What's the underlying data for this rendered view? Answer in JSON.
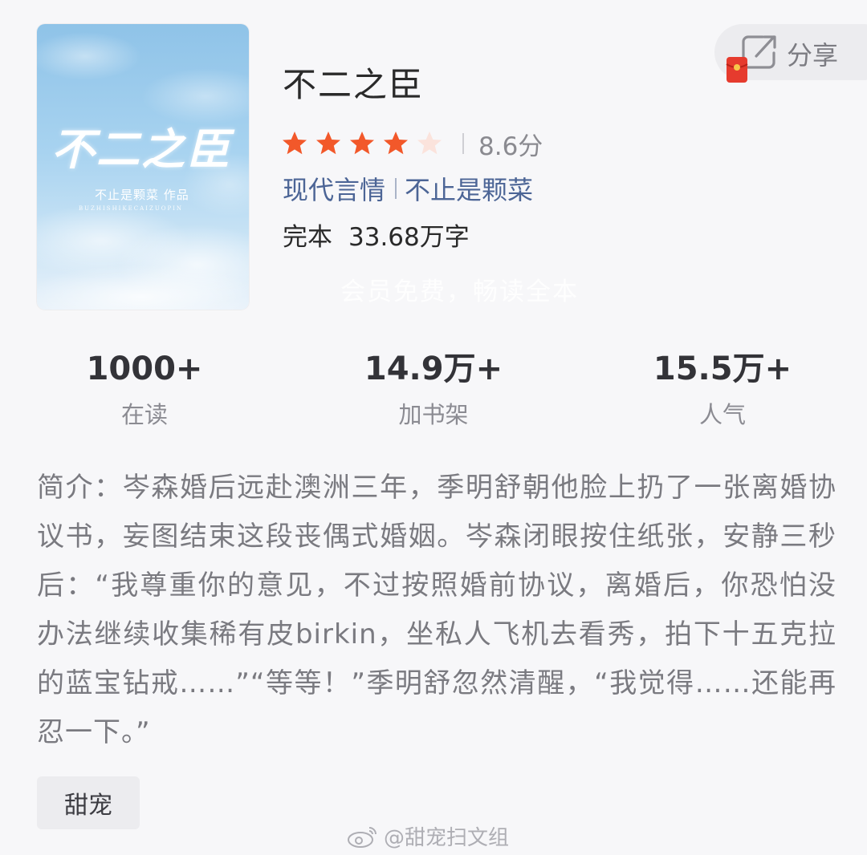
{
  "book": {
    "title": "不二之臣",
    "score": "8.6分",
    "rating_stars": 4,
    "rating_max": 5,
    "category": "现代言情",
    "author": "不止是颗菜",
    "status": "完本",
    "word_count": "33.68万字"
  },
  "cover": {
    "title_art": "不二之臣",
    "author_line": "不止是颗菜 作品",
    "roman_line": "BUZHISHIKECAIZUOPIN"
  },
  "overlay_text": "会员免费，畅读全本",
  "share": {
    "label": "分享",
    "icon": "share-icon",
    "badge_icon": "red-packet-icon"
  },
  "stats": [
    {
      "value": "1000+",
      "label": "在读"
    },
    {
      "value": "14.9万+",
      "label": "加书架"
    },
    {
      "value": "15.5万+",
      "label": "人气"
    }
  ],
  "synopsis": "简介：岑森婚后远赴澳洲三年，季明舒朝他脸上扔了一张离婚协议书，妄图结束这段丧偶式婚姻。岑森闭眼按住纸张，安静三秒后：“我尊重你的意见，不过按照婚前协议，离婚后，你恐怕没办法继续收集稀有皮birkin，坐私人飞机去看秀，拍下十五克拉的蓝宝钻戒……”“等等！”季明舒忽然清醒，“我觉得……还能再忍一下。”",
  "tags": [
    "甜宠"
  ],
  "footer_watermark": "@甜宠扫文组",
  "colors": {
    "star_active": "#f2582a",
    "star_inactive": "#fbe3dc",
    "link": "#4c6596",
    "background": "#f7f7f9"
  }
}
